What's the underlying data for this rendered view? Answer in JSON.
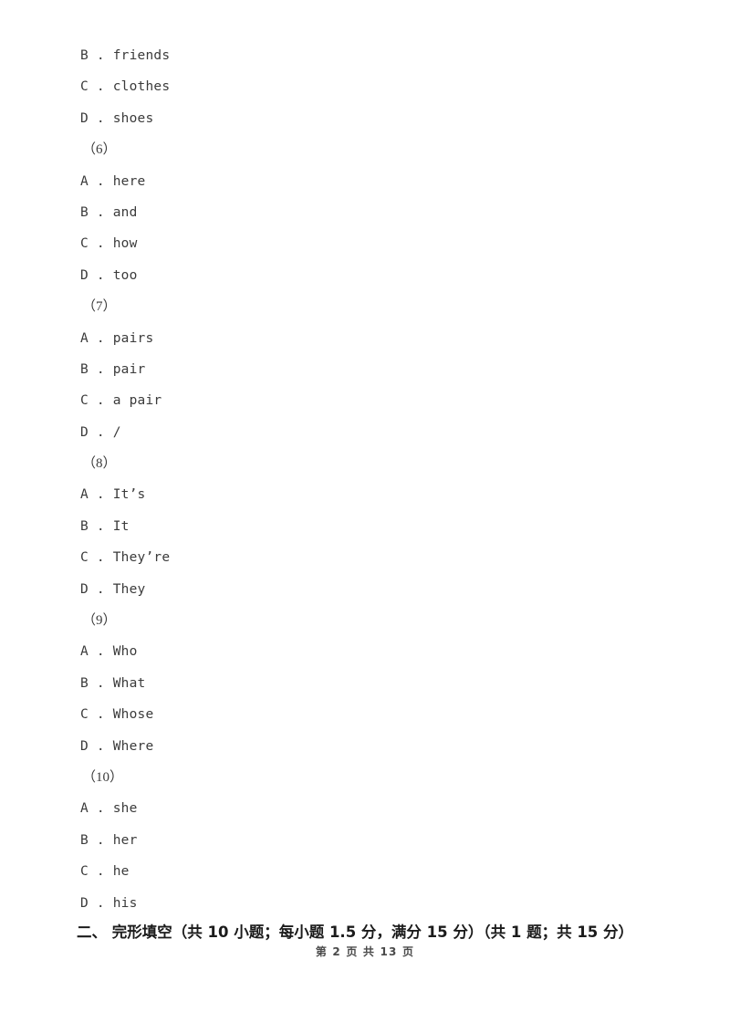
{
  "document": {
    "page_number_text": "第 2 页 共 13 页",
    "text_color": "#3a3a3a",
    "heading_color": "#1b1b1b",
    "background_color": "#ffffff"
  },
  "body_lines": [
    {
      "kind": "option",
      "letter": "B",
      "sep": " . ",
      "text": "friends"
    },
    {
      "kind": "option",
      "letter": "C",
      "sep": " . ",
      "text": "clothes"
    },
    {
      "kind": "option",
      "letter": "D",
      "sep": " . ",
      "text": "shoes"
    },
    {
      "kind": "question",
      "number": "（6）"
    },
    {
      "kind": "option",
      "letter": "A",
      "sep": " . ",
      "text": "here"
    },
    {
      "kind": "option",
      "letter": "B",
      "sep": " . ",
      "text": "and"
    },
    {
      "kind": "option",
      "letter": "C",
      "sep": " . ",
      "text": "how"
    },
    {
      "kind": "option",
      "letter": "D",
      "sep": " . ",
      "text": "too"
    },
    {
      "kind": "question",
      "number": "（7）"
    },
    {
      "kind": "option",
      "letter": "A",
      "sep": " . ",
      "text": "pairs"
    },
    {
      "kind": "option",
      "letter": "B",
      "sep": " . ",
      "text": "pair"
    },
    {
      "kind": "option",
      "letter": "C",
      "sep": " . ",
      "text": "a pair"
    },
    {
      "kind": "option",
      "letter": "D",
      "sep": " . ",
      "text": "/"
    },
    {
      "kind": "question",
      "number": "（8）"
    },
    {
      "kind": "option",
      "letter": "A",
      "sep": " . ",
      "text": "It’s"
    },
    {
      "kind": "option",
      "letter": "B",
      "sep": " . ",
      "text": "It"
    },
    {
      "kind": "option",
      "letter": "C",
      "sep": " . ",
      "text": "They’re"
    },
    {
      "kind": "option",
      "letter": "D",
      "sep": " . ",
      "text": "They"
    },
    {
      "kind": "question",
      "number": "（9）"
    },
    {
      "kind": "option",
      "letter": "A",
      "sep": " . ",
      "text": "Who"
    },
    {
      "kind": "option",
      "letter": "B",
      "sep": " . ",
      "text": "What"
    },
    {
      "kind": "option",
      "letter": "C",
      "sep": " . ",
      "text": "Whose"
    },
    {
      "kind": "option",
      "letter": "D",
      "sep": " . ",
      "text": "Where"
    },
    {
      "kind": "question",
      "number": "（10）"
    },
    {
      "kind": "option",
      "letter": "A",
      "sep": " . ",
      "text": "she"
    },
    {
      "kind": "option",
      "letter": "B",
      "sep": " . ",
      "text": "her"
    },
    {
      "kind": "option",
      "letter": "C",
      "sep": " . ",
      "text": "he"
    },
    {
      "kind": "option",
      "letter": "D",
      "sep": " . ",
      "text": "his"
    }
  ],
  "section_heading": {
    "text": "二、 完形填空（共 10 小题；每小题 1.5 分，满分 15 分）（共 1 题；共 15 分）"
  }
}
